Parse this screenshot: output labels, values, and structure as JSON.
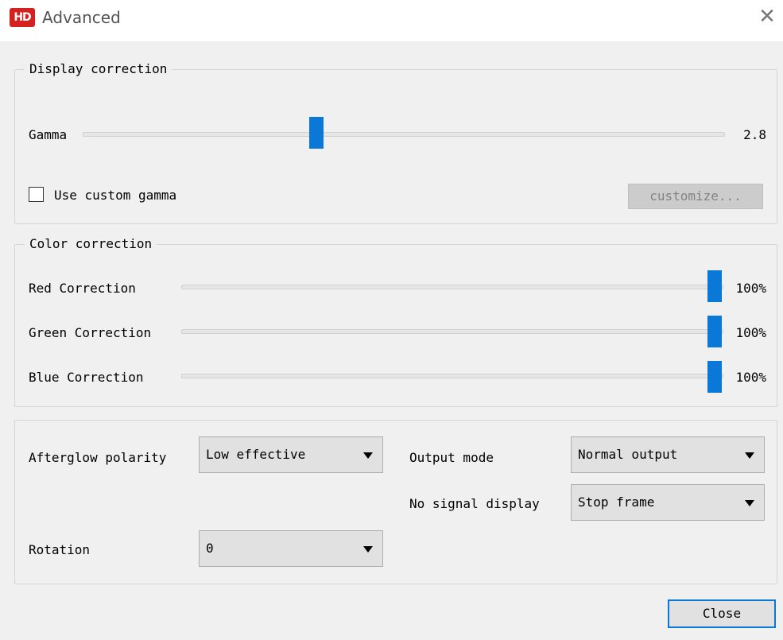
{
  "window": {
    "title": "Advanced",
    "icon_text": "HD",
    "close_glyph": "✕"
  },
  "display_correction": {
    "legend": "Display correction",
    "gamma": {
      "label": "Gamma",
      "value_text": "2.8",
      "position": 0.362
    },
    "use_custom_gamma": {
      "label": "Use custom gamma",
      "checked": false
    },
    "customize_button": "customize..."
  },
  "color_correction": {
    "legend": "Color correction",
    "red": {
      "label": "Red Correction",
      "value_text": "100%",
      "percent": 100
    },
    "green": {
      "label": "Green Correction",
      "value_text": "100%",
      "percent": 100
    },
    "blue": {
      "label": "Blue Correction",
      "value_text": "100%",
      "percent": 100
    }
  },
  "options": {
    "afterglow_polarity": {
      "label": "Afterglow polarity",
      "selected": "Low effective"
    },
    "output_mode": {
      "label": "Output mode",
      "selected": "Normal output"
    },
    "no_signal_display": {
      "label": "No signal display",
      "selected": "Stop frame"
    },
    "rotation": {
      "label": "Rotation",
      "selected": "0"
    }
  },
  "footer": {
    "close_label": "Close"
  },
  "colors": {
    "accent": "#0a78d7",
    "icon_red": "#d4201f"
  }
}
